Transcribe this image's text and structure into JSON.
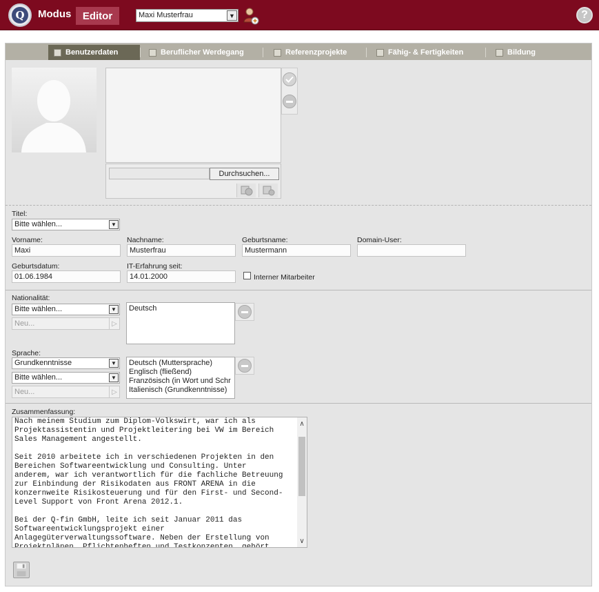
{
  "header": {
    "app_name": "Modus",
    "mode": "Editor",
    "selected_user": "Maxi Musterfrau",
    "help_symbol": "?",
    "logo_letter": "Q"
  },
  "tabs": [
    {
      "label": "Benutzerdaten",
      "active": true,
      "icon": "user-data-icon"
    },
    {
      "label": "Beruflicher Werdegang",
      "active": false,
      "icon": "career-icon"
    },
    {
      "label": "Referenzprojekte",
      "active": false,
      "icon": "folder-icon"
    },
    {
      "label": "Fähig- & Fertigkeiten",
      "active": false,
      "icon": "gear-icon"
    },
    {
      "label": "Bildung",
      "active": false,
      "icon": "book-icon"
    }
  ],
  "upload": {
    "browse_label": "Durchsuchen..."
  },
  "form": {
    "titel_label": "Titel:",
    "titel_value": "Bitte wählen...",
    "vorname_label": "Vorname:",
    "vorname_value": "Maxi",
    "nachname_label": "Nachname:",
    "nachname_value": "Musterfrau",
    "geburtsname_label": "Geburtsname:",
    "geburtsname_value": "Mustermann",
    "domain_user_label": "Domain-User:",
    "domain_user_value": "",
    "geburtsdatum_label": "Geburtsdatum:",
    "geburtsdatum_value": "01.06.1984",
    "it_erfahrung_label": "IT-Erfahrung seit:",
    "it_erfahrung_value": "14.01.2000",
    "interner_mitarbeiter_label": "Interner Mitarbeiter",
    "interner_mitarbeiter_checked": false
  },
  "nationality": {
    "label": "Nationalität:",
    "select_value": "Bitte wählen...",
    "new_placeholder": "Neu...",
    "items": [
      "Deutsch"
    ]
  },
  "language": {
    "label": "Sprache:",
    "level_value": "Grundkenntnisse",
    "select_value": "Bitte wählen...",
    "new_placeholder": "Neu...",
    "items": [
      "Deutsch (Muttersprache)",
      "Englisch (fließend)",
      "Französisch (in Wort und Schr",
      "Italienisch (Grundkenntnisse)"
    ]
  },
  "summary": {
    "label": "Zusammenfassung:",
    "text": "Nach meinem Studium zum Diplom-Volkswirt, war ich als\nProjektassistentin und Projektleitering bei VW im Bereich\nSales Management angestellt.\n\nSeit 2010 arbeitete ich in verschiedenen Projekten in den\nBereichen Softwareentwicklung und Consulting. Unter\nanderem, war ich verantwortlich für die fachliche Betreuung\nzur Einbindung der Risikodaten aus FRONT ARENA in die\nkonzernweite Risikosteuerung und für den First- und Second-\nLevel Support von Front Arena 2012.1.\n\nBei der Q-fin GmbH, leite ich seit Januar 2011 das\nSoftwareentwicklungsprojekt einer\nAnlagegüterverwaltungssoftware. Neben der Erstellung von\nProjektplänen, Pflichtenheften und Testkonzepten, gehört"
  }
}
